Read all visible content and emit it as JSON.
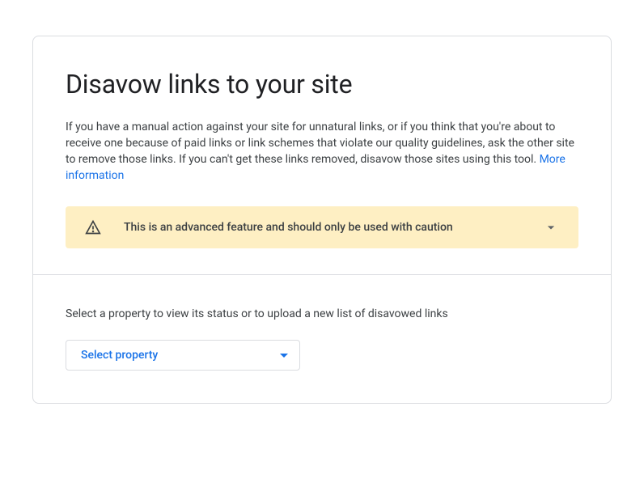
{
  "title": "Disavow links to your site",
  "description": "If you have a manual action against your site for unnatural links, or if you think that you're about to receive one because of paid links or link schemes that violate our quality guidelines, ask the other site to remove those links. If you can't get these links removed, disavow those sites using this tool. ",
  "more_info_label": "More information",
  "warning": {
    "text": "This is an advanced feature and should only be used with caution"
  },
  "select": {
    "label": "Select a property to view its status or to upload a new list of disavowed links",
    "selected": "Select property"
  }
}
